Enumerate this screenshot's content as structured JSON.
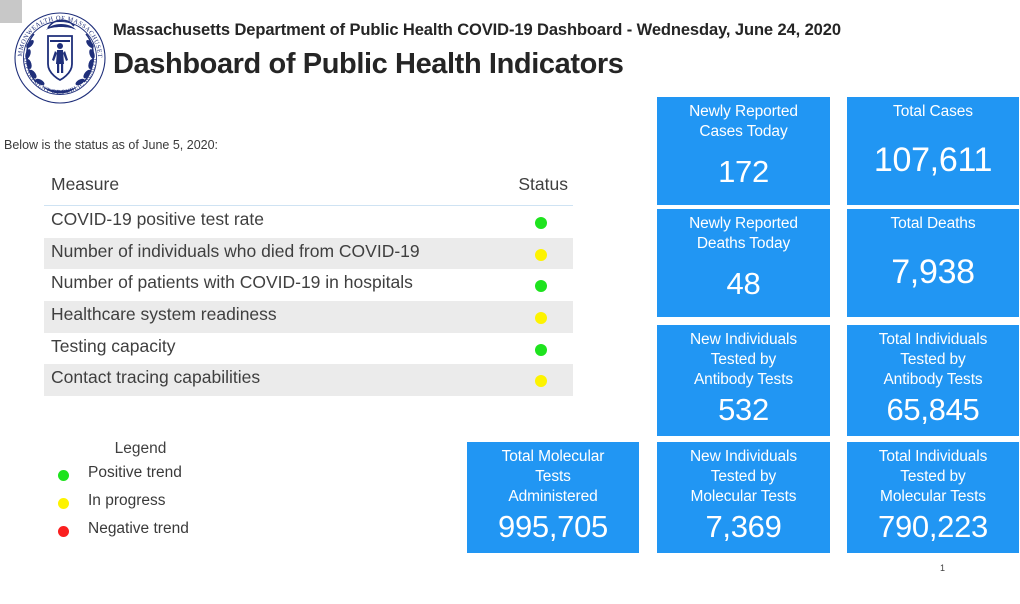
{
  "header": {
    "line1": "Massachusetts Department of Public Health COVID-19 Dashboard -  Wednesday, June 24, 2020",
    "line2": "Dashboard of Public Health Indicators",
    "seal_outer_top": "COMMONWEALTH OF MASSACHUSETTS",
    "seal_outer_bottom": "DEPARTMENT OF PUBLIC HEALTH"
  },
  "status_note": "Below is the status as of June 5, 2020:",
  "table": {
    "columns": [
      "Measure",
      "Status"
    ],
    "rows": [
      {
        "measure": "COVID-19 positive test rate",
        "status": "green"
      },
      {
        "measure": "Number of individuals who died from COVID-19",
        "status": "yellow"
      },
      {
        "measure": "Number of patients with COVID-19 in hospitals",
        "status": "green"
      },
      {
        "measure": "Healthcare system readiness",
        "status": "yellow"
      },
      {
        "measure": "Testing capacity",
        "status": "green"
      },
      {
        "measure": "Contact tracing capabilities",
        "status": "yellow"
      }
    ]
  },
  "legend": {
    "title": "Legend",
    "items": [
      {
        "label": "Positive trend",
        "color": "green"
      },
      {
        "label": "In progress",
        "color": "yellow"
      },
      {
        "label": "Negative trend",
        "color": "red"
      }
    ]
  },
  "cards": [
    {
      "title": "Newly Reported\nCases Today",
      "value": "172"
    },
    {
      "title": "Total Cases",
      "value": "107,611"
    },
    {
      "title": "Newly Reported\nDeaths Today",
      "value": "48"
    },
    {
      "title": "Total Deaths",
      "value": "7,938"
    },
    {
      "title": "New Individuals\nTested by\nAntibody Tests",
      "value": "532"
    },
    {
      "title": "Total Individuals\nTested by\nAntibody Tests",
      "value": "65,845"
    },
    {
      "title": "Total Molecular\nTests\nAdministered",
      "value": "995,705"
    },
    {
      "title": "New Individuals\nTested by\nMolecular Tests",
      "value": "7,369"
    },
    {
      "title": "Total Individuals\nTested by\nMolecular Tests",
      "value": "790,223"
    }
  ],
  "page_number": "1",
  "colors": {
    "card_blue": "#2196f3",
    "green": "#1ee31e",
    "yellow": "#fdf300",
    "red": "#fa1f1f",
    "row_alt": "#ebebeb",
    "header_rule": "#cfe3f3",
    "seal_navy": "#1f2f7a"
  }
}
